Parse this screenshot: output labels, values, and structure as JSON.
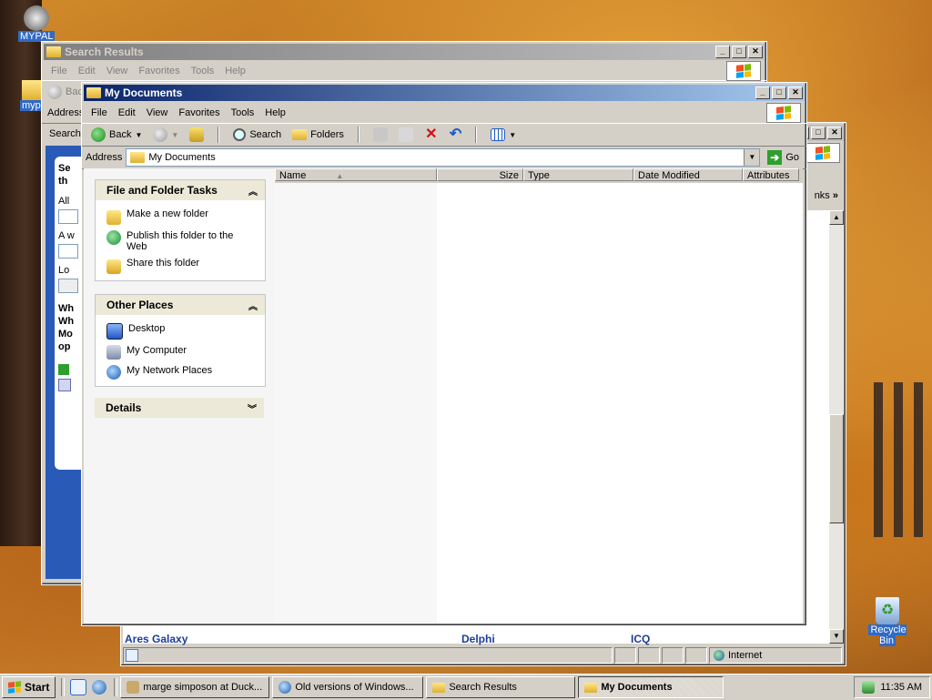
{
  "desktop": {
    "icons": [
      {
        "label": "MYPAL"
      },
      {
        "label": "mypal"
      },
      {
        "label": "Recycle Bin"
      }
    ]
  },
  "search_window": {
    "title": "Search Results",
    "menu": [
      "File",
      "Edit",
      "View",
      "Favorites",
      "Tools",
      "Help"
    ],
    "back_label": "Back",
    "address_label": "Address",
    "search_tab": "Search",
    "pane_lines": [
      "Se",
      "th",
      "All",
      "A w",
      "Lo",
      "Wh",
      "Wh",
      "Mo",
      "op"
    ]
  },
  "browser_window": {
    "links_label": "nks",
    "rows": [
      [
        "Ares Galaxy",
        "",
        "Delphi",
        "ICQ"
      ]
    ],
    "status_zone": "Internet"
  },
  "explorer": {
    "title": "My Documents",
    "menu": [
      "File",
      "Edit",
      "View",
      "Favorites",
      "Tools",
      "Help"
    ],
    "toolbar": {
      "back": "Back",
      "search": "Search",
      "folders": "Folders"
    },
    "address_label": "Address",
    "address_value": "My Documents",
    "go_label": "Go",
    "columns": [
      "Name",
      "Size",
      "Type",
      "Date Modified",
      "Attributes"
    ],
    "task_groups": {
      "file_tasks": {
        "title": "File and Folder Tasks",
        "items": [
          "Make a new folder",
          "Publish this folder to the Web",
          "Share this folder"
        ]
      },
      "other_places": {
        "title": "Other Places",
        "items": [
          "Desktop",
          "My Computer",
          "My Network Places"
        ]
      },
      "details": {
        "title": "Details"
      }
    }
  },
  "taskbar": {
    "start": "Start",
    "tasks": [
      "marge simposon at Duck...",
      "Old versions of Windows...",
      "Search Results",
      "My Documents"
    ],
    "clock": "11:35 AM"
  }
}
